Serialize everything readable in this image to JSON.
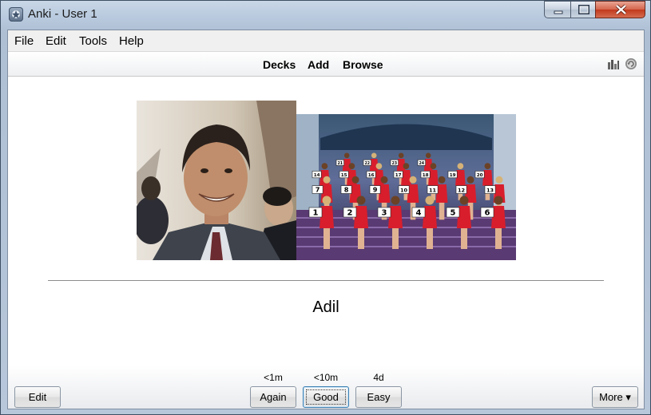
{
  "window": {
    "title": "Anki - User 1"
  },
  "menu": {
    "file": "File",
    "edit": "Edit",
    "tools": "Tools",
    "help": "Help"
  },
  "toolbar": {
    "decks": "Decks",
    "add": "Add",
    "browse": "Browse",
    "icons": [
      "stats-icon",
      "sync-icon"
    ]
  },
  "card": {
    "images": [
      "portrait-photo",
      "pageant-contestants-photo"
    ],
    "answer": "Adil",
    "pageant_numbers": [
      "1",
      "2",
      "3",
      "4",
      "5",
      "6",
      "7",
      "8",
      "9",
      "10",
      "11",
      "12",
      "13",
      "14",
      "15",
      "16",
      "17",
      "18",
      "19",
      "20",
      "21",
      "22",
      "23",
      "24"
    ]
  },
  "bottom": {
    "edit": "Edit",
    "more": "More ▾",
    "answers": [
      {
        "label": "Again",
        "interval": "<1m"
      },
      {
        "label": "Good",
        "interval": "<10m"
      },
      {
        "label": "Easy",
        "interval": "4d"
      }
    ]
  }
}
